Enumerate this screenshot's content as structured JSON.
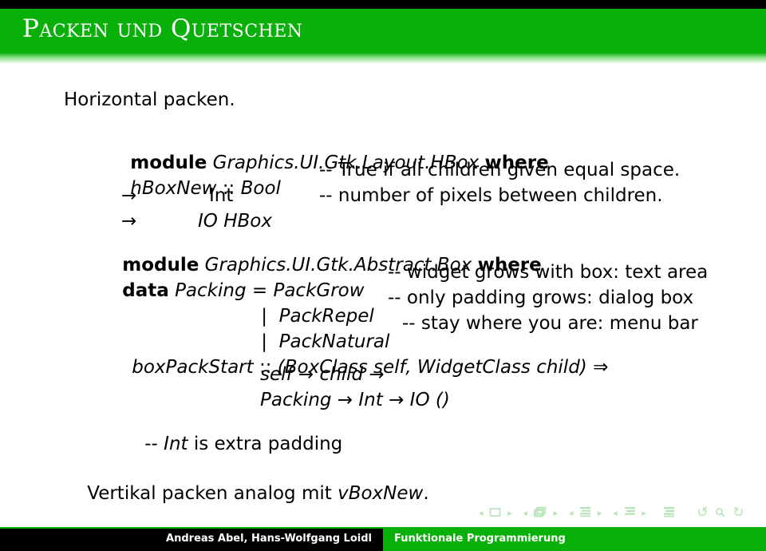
{
  "header": {
    "title": "Packen und Quetschen",
    "bg_color": "#0ab00a",
    "title_color": "#ffffff",
    "top_strip_color": "#000000"
  },
  "body": {
    "intro_line": "Horizontal packen.",
    "closing_line_prefix": "Vertikal packen analog mit ",
    "closing_line_code": "vBoxNew",
    "closing_line_suffix": "."
  },
  "code": {
    "module_hbox": {
      "keyword": "module",
      "name": "Graphics.UI.Gtk.Layout.HBox",
      "where": "where"
    },
    "hboxnew": {
      "name": "hBoxNew",
      "sig_op": "::",
      "type1": "Bool",
      "comment1": "-- True if all children given equal space.",
      "arrow": "→",
      "type2": "Int",
      "comment2": "-- number of pixels between children.",
      "type3": "IO HBox"
    },
    "module_box": {
      "keyword": "module",
      "name": "Graphics.UI.Gtk.Abstract.Box",
      "where": "where"
    },
    "packing": {
      "keyword": "data",
      "type_name": "Packing",
      "equals": "=",
      "bar": "|",
      "constructors": [
        {
          "name": "PackGrow",
          "comment": "-- widget grows with box: text area"
        },
        {
          "name": "PackRepel",
          "comment": "-- only padding grows: dialog box"
        },
        {
          "name": "PackNatural",
          "comment": "-- stay where you are: menu bar"
        }
      ]
    },
    "boxpackstart": {
      "name": "boxPackStart",
      "sig_op": "::",
      "context": "(BoxClass self, WidgetClass child)",
      "darrow": "⇒",
      "line2": "self → child →",
      "line3": "Packing → Int → IO ()",
      "comment_prefix": "-- ",
      "comment_code": "Int",
      "comment_suffix": " is extra padding"
    }
  },
  "navigation": {
    "color": "#b6e3b6",
    "groups": [
      {
        "icon": "slide-icon",
        "prev": "◂",
        "next": "▸"
      },
      {
        "icon": "frames-icon",
        "prev": "◂",
        "next": "▸"
      },
      {
        "icon": "subsection-icon",
        "prev": "◂",
        "next": "▸"
      },
      {
        "icon": "section-icon",
        "prev": "◂",
        "next": "▸"
      }
    ],
    "presentation_icon": "presentation-icon",
    "back_icon": "↺",
    "search_icon": "search-icon",
    "forward_icon": "↻"
  },
  "footer": {
    "authors": "Andreas Abel, Hans-Wolfgang Loidl",
    "course": "Funktionale Programmierung",
    "left_bg": "#000000",
    "right_bg": "#0ab00a",
    "text_color": "#ffffff"
  }
}
